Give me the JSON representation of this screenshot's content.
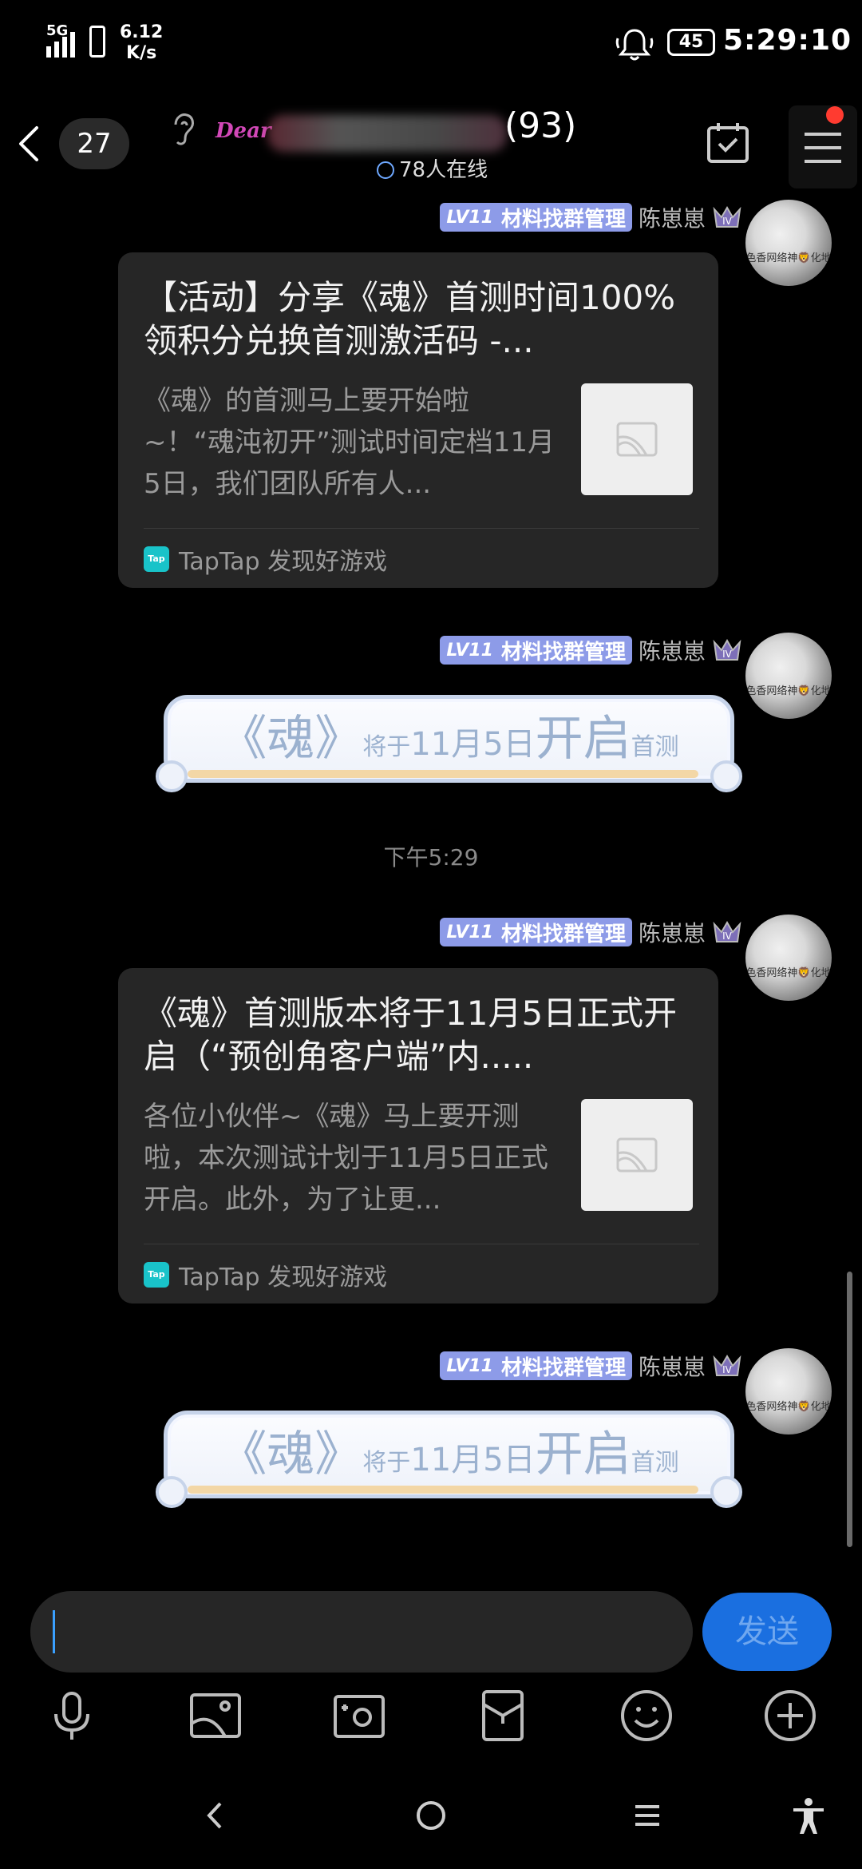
{
  "status_bar": {
    "network": "5G",
    "speed_value": "6.12",
    "speed_unit": "K/s",
    "battery": "45",
    "time": "5:29:10"
  },
  "header": {
    "unread_count": "27",
    "group_logo_text": "Dear",
    "group_member_count": "(93)",
    "online_text": "78人在线"
  },
  "messages": [
    {
      "type": "link_card",
      "sender_badge_level": "LV11",
      "sender_badge_title": "材料找群管理",
      "sender_name": "陈崽崽",
      "avatar_caption": "色香网络神🦁化地",
      "card_title": "【活动】分享《魂》首测时间100%领积分兑换首测激活码 -...",
      "card_desc": "《魂》的首测马上要开始啦~！“魂沌初开”测试时间定档11月5日，我们团队所有人...",
      "card_source": "TapTap 发现好游戏"
    },
    {
      "type": "sticker",
      "sender_badge_level": "LV11",
      "sender_badge_title": "材料找群管理",
      "sender_name": "陈崽崽",
      "avatar_caption": "色香网络神🦁化地",
      "sticker_parts": [
        "《魂》",
        "将于",
        "11月5日",
        "开启",
        "首测"
      ]
    },
    {
      "type": "time",
      "text": "下午5:29"
    },
    {
      "type": "link_card",
      "sender_badge_level": "LV11",
      "sender_badge_title": "材料找群管理",
      "sender_name": "陈崽崽",
      "avatar_caption": "色香网络神🦁化地",
      "card_title": "《魂》首测版本将于11月5日正式开启（“预创角客户端”内.....",
      "card_desc": "各位小伙伴~《魂》马上要开测啦，本次测试计划于11月5日正式开启。此外，为了让更...",
      "card_source": "TapTap 发现好游戏"
    },
    {
      "type": "sticker",
      "sender_badge_level": "LV11",
      "sender_badge_title": "材料找群管理",
      "sender_name": "陈崽崽",
      "avatar_caption": "色香网络神🦁化地",
      "sticker_parts": [
        "《魂》",
        "将于",
        "11月5日",
        "开启",
        "首测"
      ]
    }
  ],
  "input": {
    "send_label": "发送"
  },
  "toolbar": {
    "items": [
      "microphone-icon",
      "image-icon",
      "camera-icon",
      "red-packet-icon",
      "emoji-icon",
      "plus-icon"
    ]
  },
  "colors": {
    "badge": "#8d9be8",
    "send": "#1a6fe0",
    "tap_logo": "#19c3c9"
  }
}
